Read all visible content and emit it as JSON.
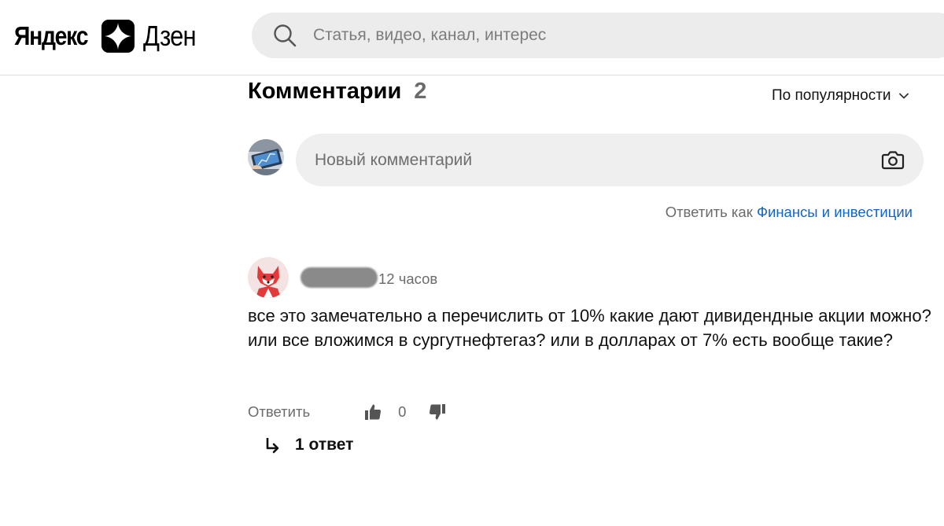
{
  "brand": {
    "yandex": "Яндекс",
    "dzen": "Дзен"
  },
  "search": {
    "placeholder": "Статья, видео, канал, интерес"
  },
  "comments": {
    "title": "Комментарии",
    "count": "2",
    "sort_label": "По популярности",
    "new_comment_placeholder": "Новый комментарий",
    "reply_as_prefix": "Ответить как",
    "reply_as_name": "Финансы и инвестиции"
  },
  "comment": {
    "time": "12 часов",
    "text": "все это замечательно а перечислить от 10% какие дают дивидендные акции можно? или все вложимся в сургутнефтегаз? или в долларах от 7% есть вообще такие?",
    "reply_label": "Ответить",
    "likes": "0",
    "replies_label": "1 ответ"
  },
  "icons": {
    "search": "search-icon",
    "camera": "camera-icon",
    "chevron": "chevron-down-icon",
    "like": "thumbs-up-icon",
    "dislike": "thumbs-down-icon",
    "reply_arrow": "reply-arrow-icon"
  },
  "colors": {
    "link": "#1565c0",
    "avatar_red": "#e23a3a"
  }
}
